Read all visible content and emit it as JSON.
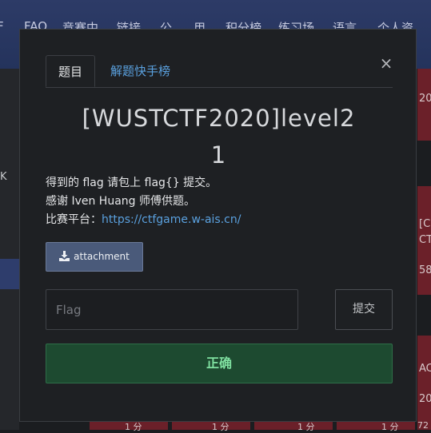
{
  "background": {
    "nav_items": [
      "FAQ",
      "竞赛中",
      "链接",
      "公",
      "用",
      "积分榜",
      "练习场",
      "语言",
      "个人资"
    ],
    "nav_edge_glyph": "F",
    "left_fragment": "K",
    "right_fragments": [
      "20",
      "[C",
      "CTF",
      "58",
      "AC",
      "20"
    ],
    "bottom_fragments": [
      "1 分",
      "1 分",
      "1 分",
      "1 分",
      "72"
    ]
  },
  "modal": {
    "tabs": [
      {
        "label": "题目",
        "active": true
      },
      {
        "label": "解题快手榜",
        "active": false
      }
    ],
    "close_label": "×",
    "title_line1": "[WUSTCTF2020]level2",
    "title_line2": "1",
    "description": {
      "line1": "得到的 flag 请包上 flag{} 提交。",
      "line2": "感谢 Iven Huang 师傅供题。",
      "line3_prefix": "比赛平台：",
      "link_text": "https://ctfgame.w-ais.cn/"
    },
    "attachment_label": "attachment",
    "flag_input": {
      "placeholder": "Flag",
      "value": ""
    },
    "submit_label": "提交",
    "result_text": "正确"
  },
  "colors": {
    "accent_link": "#5aa0de",
    "success_bg": "#1d4a30",
    "success_text": "#7fe0a0",
    "nav_bg": "#2d3b67",
    "card_red": "#6b2029"
  },
  "icons": {
    "close": "close-icon",
    "download": "download-icon"
  }
}
